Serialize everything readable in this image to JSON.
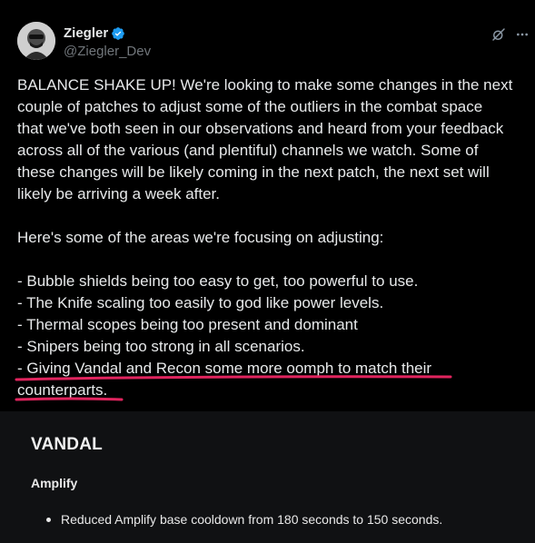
{
  "tweet": {
    "author": {
      "display_name": "Ziegler",
      "handle": "@Ziegler_Dev",
      "verified_icon": "verified-badge-icon"
    },
    "header_actions": [
      "grok-icon",
      "more-icon"
    ],
    "lines": [
      "BALANCE SHAKE UP! We're looking to make some changes in the next",
      "couple of patches to adjust some of the outliers in the combat space",
      "that we've both seen in our observations and heard from your feedback",
      "across all of the various (and plentiful) channels we watch. Some of",
      "these changes will be likely coming in the next patch, the next set will",
      "likely be arriving a week after.",
      "",
      "Here's some of the areas we're focusing on adjusting:",
      "",
      "- Bubble shields being too easy to get, too powerful to use.",
      "- The Knife scaling too easily to god like power levels.",
      "- Thermal scopes being too present and dominant",
      "- Snipers being too strong in all scenarios.",
      "- Giving Vandal and Recon some more oomph to match their",
      "counterparts."
    ],
    "highlight_color": "#e0245e"
  },
  "patch_notes": {
    "title": "VANDAL",
    "subtitle": "Amplify",
    "items": [
      "Reduced Amplify base cooldown from 180 seconds to 150 seconds."
    ]
  },
  "colors": {
    "tweet_bg": "#000000",
    "patch_bg": "#101113",
    "verified_blue": "#1d9bf0",
    "handle_gray": "#71767b"
  }
}
